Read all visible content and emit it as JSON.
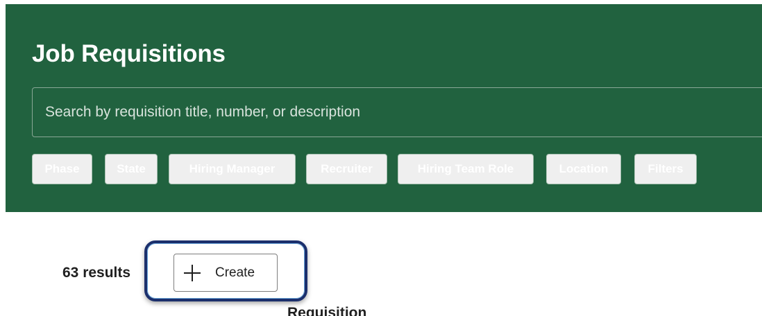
{
  "header": {
    "title": "Job Requisitions"
  },
  "search": {
    "placeholder": "Search by requisition title, number, or description",
    "value": ""
  },
  "filters": [
    {
      "label": "Phase"
    },
    {
      "label": "State"
    },
    {
      "label": "Hiring Manager"
    },
    {
      "label": "Recruiter"
    },
    {
      "label": "Hiring Team Role"
    },
    {
      "label": "Location"
    },
    {
      "label": "Filters"
    }
  ],
  "results": {
    "count_text": "63 results"
  },
  "actions": {
    "create_label": "Create",
    "create_icon": "plus-icon"
  },
  "table": {
    "partial_header": "Requisition"
  },
  "colors": {
    "header_green": "#21623f",
    "highlight_outline": "#1b2f6c"
  }
}
